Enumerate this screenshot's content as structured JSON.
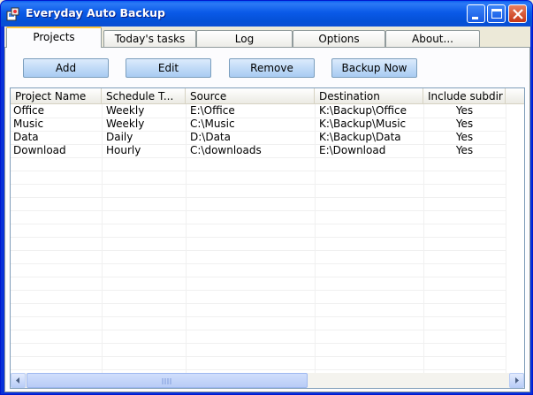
{
  "window": {
    "title": "Everyday Auto Backup",
    "icon": "app-backup-icon"
  },
  "tabs": [
    {
      "label": "Projects",
      "active": true
    },
    {
      "label": "Today's tasks",
      "active": false
    },
    {
      "label": "Log",
      "active": false
    },
    {
      "label": "Options",
      "active": false
    },
    {
      "label": "About...",
      "active": false
    }
  ],
  "toolbar": {
    "add_label": "Add",
    "edit_label": "Edit",
    "remove_label": "Remove",
    "backup_now_label": "Backup Now"
  },
  "table": {
    "columns": [
      "Project Name",
      "Schedule T...",
      "Source",
      "Destination",
      "Include subdir"
    ],
    "rows": [
      [
        "Office",
        "Weekly",
        "E:\\Office",
        "K:\\Backup\\Office",
        "Yes"
      ],
      [
        "Music",
        "Weekly",
        "C:\\Music",
        "K:\\Backup\\Music",
        "Yes"
      ],
      [
        "Data",
        "Daily",
        "D:\\Data",
        "K:\\Backup\\Data",
        "Yes"
      ],
      [
        "Download",
        "Hourly",
        "C:\\downloads",
        "E:\\Download",
        "Yes"
      ]
    ]
  },
  "scrollbar": {
    "left_icon": "arrow-left-icon",
    "right_icon": "arrow-right-icon"
  },
  "colors": {
    "title_bar": "#0A5AE8",
    "active_tab_accent": "#FFC83C",
    "button": "#C1DBF7"
  }
}
